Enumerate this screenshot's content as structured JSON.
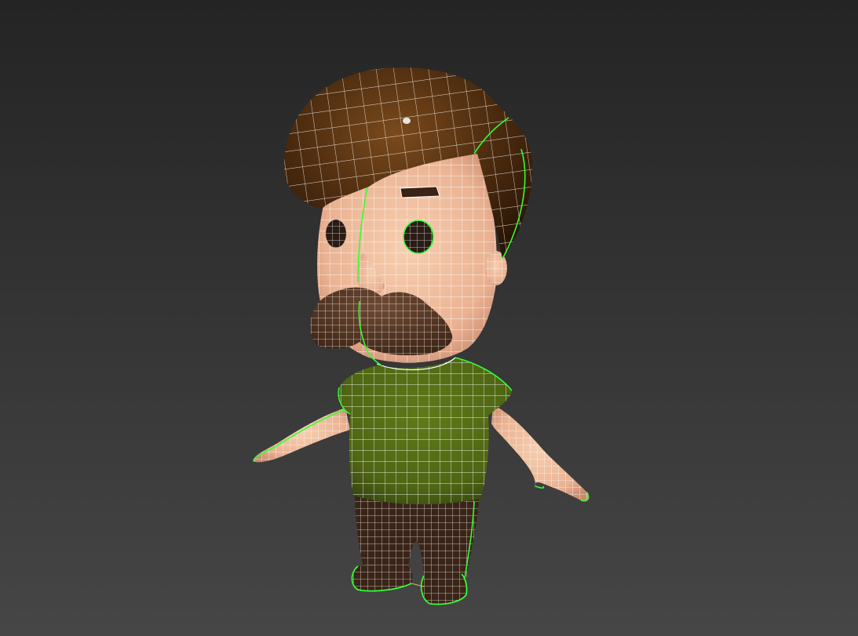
{
  "viewport": {
    "shading_mode": "edged-faces",
    "selected": true
  },
  "model": {
    "hair_color": "#4a2a0e",
    "skin_color": "#f2c09e",
    "shirt_color": "#4f6614",
    "pants_color": "#3a2418",
    "shoe_color": "#3a2418",
    "mustache_color": "#4a2e1c",
    "wire_color": "#ffffff",
    "selection_color": "#33ff33"
  }
}
